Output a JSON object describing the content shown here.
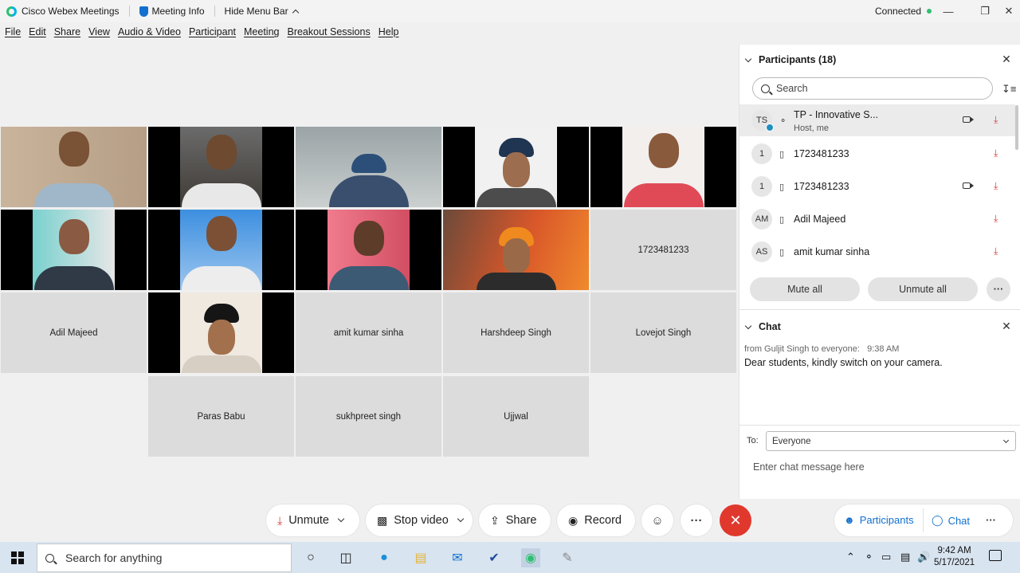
{
  "titlebar": {
    "app_name": "Cisco Webex Meetings",
    "meeting_info": "Meeting Info",
    "hide_menu": "Hide Menu Bar",
    "status": "Connected"
  },
  "menu": [
    "File",
    "Edit",
    "Share",
    "View",
    "Audio & Video",
    "Participant",
    "Meeting",
    "Breakout Sessions",
    "Help"
  ],
  "tiles": {
    "t11": "1723481233",
    "t12": "Adil Majeed",
    "t14": "amit kumar sinha",
    "t15": "Harshdeep Singh",
    "t16": "Lovejot Singh",
    "t17": "Paras Babu",
    "t18": "sukhpreet singh",
    "t19": "Ujjwal"
  },
  "participants": {
    "title": "Participants (18)",
    "search_placeholder": "Search",
    "rows": [
      {
        "initials": "TS",
        "name": "TP - Innovative S...",
        "sub": "Host, me"
      },
      {
        "initials": "1",
        "name": "1723481233"
      },
      {
        "initials": "1",
        "name": "1723481233"
      },
      {
        "initials": "AM",
        "name": "Adil Majeed"
      },
      {
        "initials": "AS",
        "name": "amit kumar sinha"
      }
    ],
    "mute_all": "Mute all",
    "unmute_all": "Unmute all",
    "more": "···"
  },
  "chat": {
    "title": "Chat",
    "meta": "from Guljit Singh to everyone:   9:38 AM",
    "message": "Dear students, kindly switch on your camera.",
    "to_label": "To:",
    "to_value": "Everyone",
    "input_placeholder": "Enter chat message here"
  },
  "controls": {
    "unmute": "Unmute",
    "stop_video": "Stop video",
    "share": "Share",
    "record": "Record",
    "more": "···",
    "participants": "Participants",
    "chat": "Chat"
  },
  "taskbar": {
    "search_placeholder": "Search for anything",
    "time": "9:42 AM",
    "date": "5/17/2021"
  },
  "colors": {
    "accent": "#1170cf",
    "end_call": "#e0382d",
    "muted_mic": "#d83b3b",
    "connected": "#2fbf71"
  }
}
